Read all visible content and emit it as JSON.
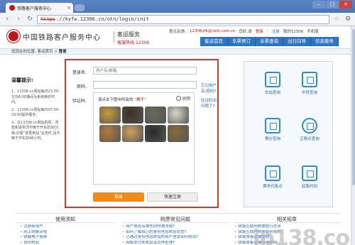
{
  "browser": {
    "tab_title": "铁路客户服务中心",
    "tab_close": "×",
    "url_scheme": "https",
    "url_rest": "://kyfw.12306.cn/otn/login/init",
    "back_icon": "‹",
    "forward_icon": "›",
    "reload_icon": "↻",
    "star_icon": "☆",
    "wrench_icon": "⚙",
    "min_label": "–",
    "max_label": "□",
    "close_label": "×"
  },
  "header": {
    "logo_text": "中国铁路客户服务中心",
    "sub_title": "客运服务",
    "hotline": "客服热线:12306"
  },
  "toplinks": {
    "welcome": "意见反馈:",
    "email": "12306yfk@rails.com.cn",
    "greeting": "您好,请",
    "login": "登录",
    "register": "注册",
    "my": "我的12306",
    "mobile": "手机版"
  },
  "nav": [
    "客运首页",
    "车票预订",
    "余票查询",
    "出行向导",
    "信息服务"
  ],
  "breadcrumb": {
    "prefix": "您现在的位置:",
    "home": "客运首页",
    "sep": " > ",
    "current": "登录"
  },
  "tips": {
    "title": "温馨提示:",
    "items": [
      "1、12306.cn网站每日23:00-次日6:00期间为系统维护时间。",
      "2、12306.cn网站每日07:00-23:00提供服务。",
      "3、在12306.cn网站购票、改签和退票须不晚于开车前30分钟;办理“变更到站”业务时,请不晚于开车前48小时。"
    ]
  },
  "login": {
    "username_label": "登录名:",
    "username_placeholder": "用户名/邮箱",
    "password_label": "密码:",
    "forgot": "忘记用户名/密码?",
    "captcha_label": "验证码:",
    "captcha_help": "验证码出问题了?",
    "captcha_hint_prefix": "请点击下图中所有的",
    "captcha_hint_target": "“椰子”",
    "captcha_refresh": "刷新",
    "login_button": "登录",
    "register_button": "快速注册",
    "captcha_images": [
      "#c89a3a",
      "#3d3020",
      "#6a6a58",
      "#d8d8c8",
      "#b07c40",
      "#cfa060",
      "#2a2a2a",
      "#8a6a3a"
    ]
  },
  "services": [
    {
      "label": "车站查询",
      "icon": "station-icon"
    },
    {
      "label": "中转查询",
      "icon": "transfer-icon"
    },
    {
      "label": "票价查询",
      "icon": "price-icon"
    },
    {
      "label": "正晚点查询",
      "icon": "clock-icon"
    },
    {
      "label": "票务代售点",
      "icon": "agent-icon"
    },
    {
      "label": "起售时间",
      "icon": "calendar-icon"
    }
  ],
  "footer": {
    "cols": [
      {
        "title": "使用须知",
        "links": [
          "注册新用户",
          "网上购票流程",
          "铁路电子客票",
          "身份核验"
        ]
      },
      {
        "title": "购票常见问题",
        "links": [
          "用户信息有哪些同时被冻结?",
          "如何了解自己的身份信息核验状态?",
          "已通过身份信息核验的用户信息如何修改?",
          "网络支付失败后该怎样处理?"
        ]
      },
      {
        "title": "相关规章",
        "links": [
          "铁路互联网购票暂行办法",
          "铁路互联网购票服务规则",
          "铁路旅客运输规程",
          "铁路旅客运输办理细则"
        ]
      }
    ]
  },
  "watermark": "ip138.com"
}
